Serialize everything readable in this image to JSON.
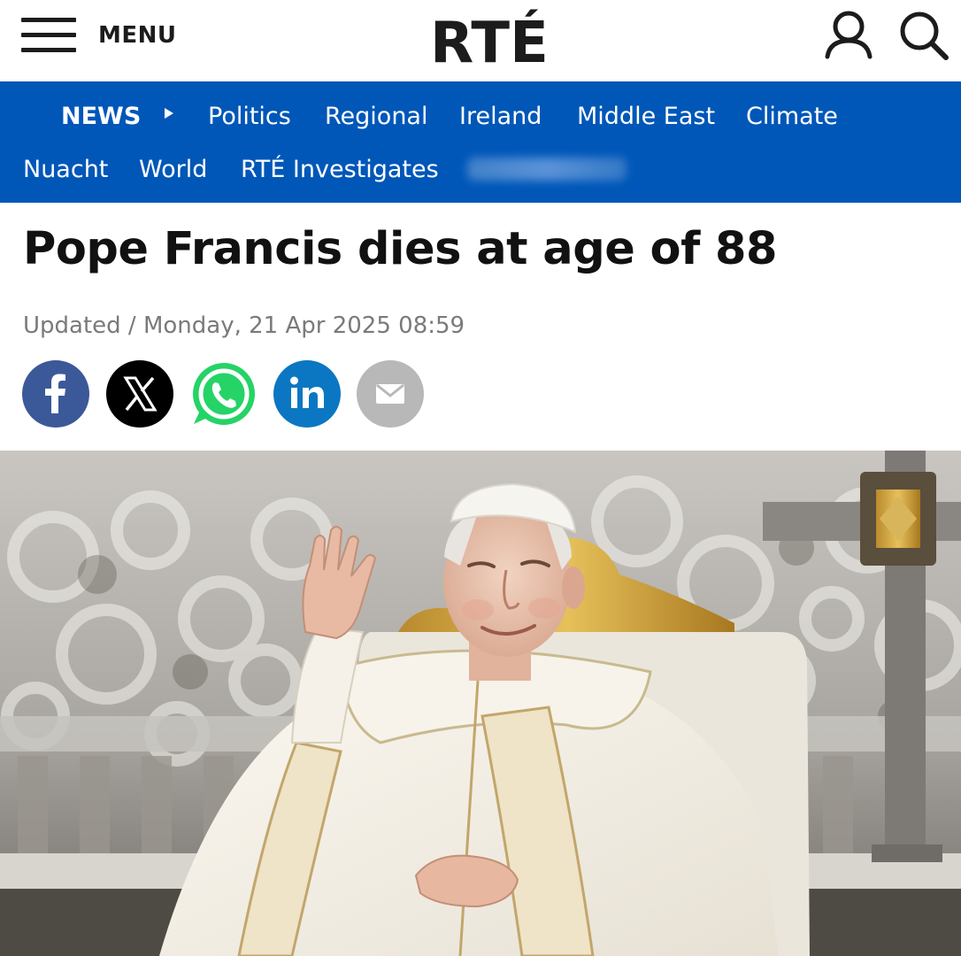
{
  "header": {
    "menu_label": "MENU",
    "logo_text": "RTÉ",
    "user_icon": "user-icon",
    "search_icon": "search-icon"
  },
  "nav": {
    "section": "NEWS",
    "items_row1": [
      "Politics",
      "Regional",
      "Ireland",
      "Middle East",
      "Climate"
    ],
    "items_row2": [
      "Nuacht",
      "World",
      "RTÉ Investigates"
    ],
    "background": "#0057b8"
  },
  "article": {
    "headline": "Pope Francis dies at age of 88",
    "updated": "Updated / Monday, 21 Apr 2025 08:59"
  },
  "share": {
    "facebook": {
      "icon": "facebook-icon",
      "color": "#3b5998"
    },
    "x": {
      "icon": "x-icon",
      "color": "#000000"
    },
    "whatsapp": {
      "icon": "whatsapp-icon",
      "color": "#25d366"
    },
    "linkedin": {
      "icon": "linkedin-icon",
      "color": "#0b77c2"
    },
    "email": {
      "icon": "email-icon",
      "color": "#b8b8b8"
    }
  },
  "hero": {
    "image": "photo of the Pope in white vestments waving, seated on a chair before an ornate balustrade with a cross"
  }
}
